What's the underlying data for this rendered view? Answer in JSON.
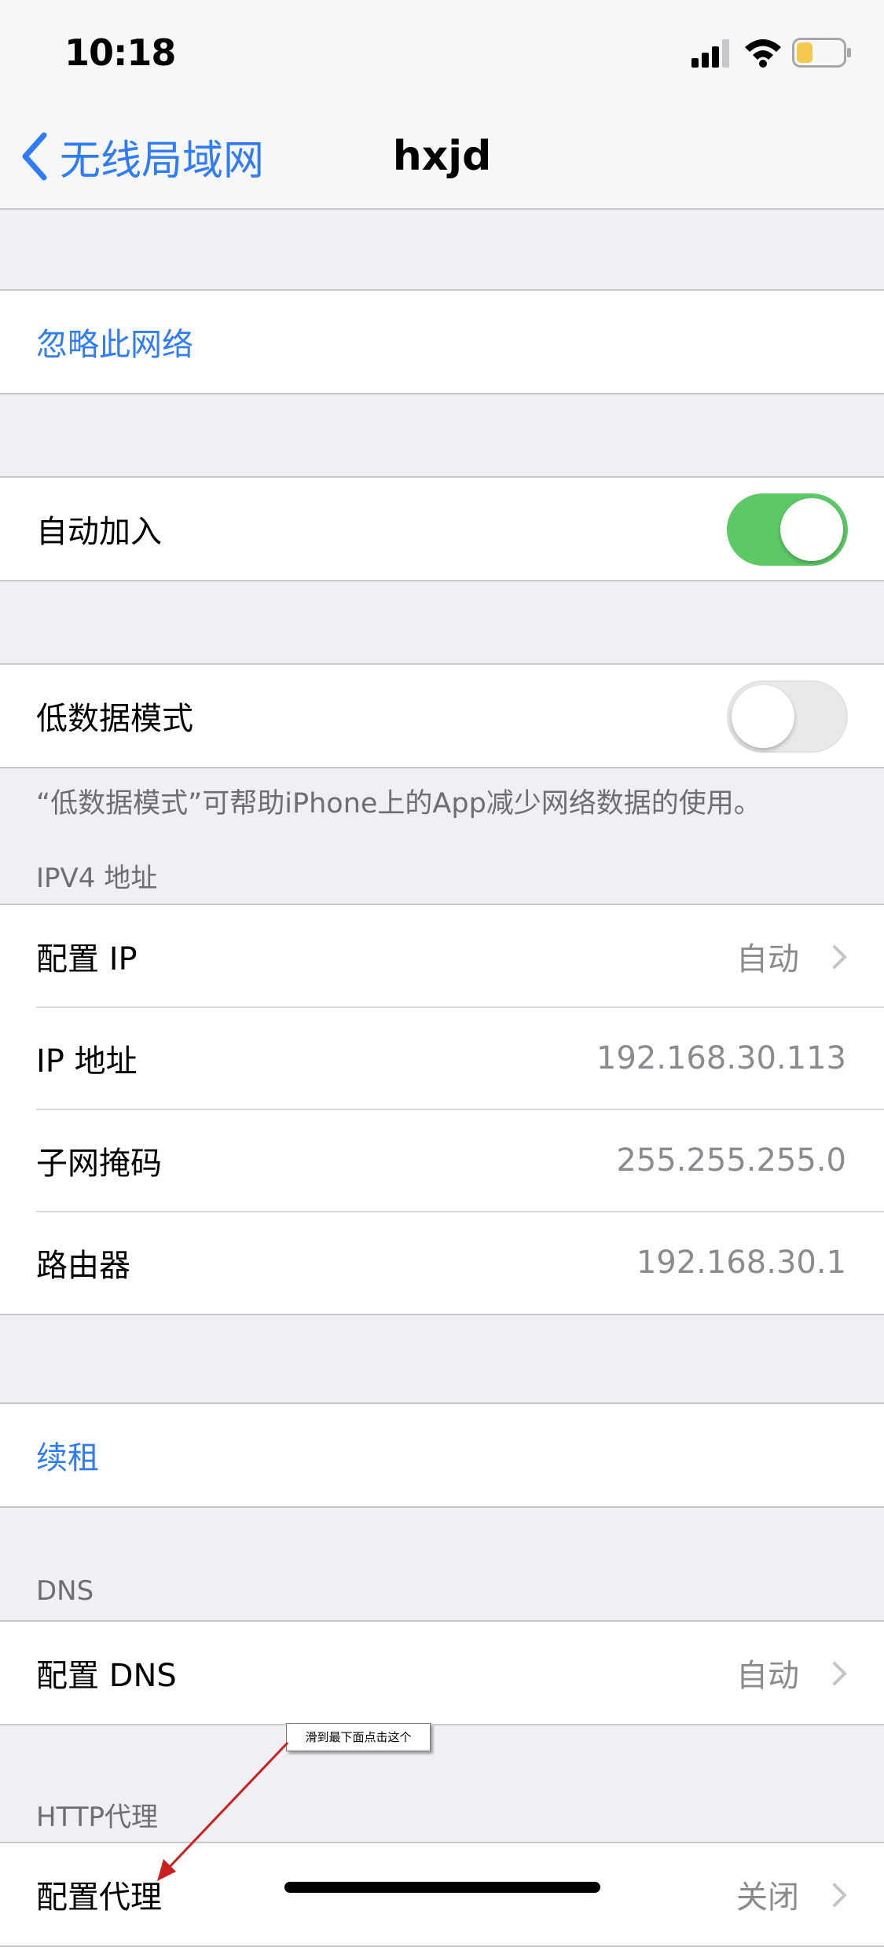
{
  "status": {
    "time": "10:18"
  },
  "nav": {
    "back_label": "无线局域网",
    "title": "hxjd"
  },
  "forget": {
    "label": "忽略此网络"
  },
  "auto_join": {
    "label": "自动加入",
    "enabled": true
  },
  "low_data": {
    "label": "低数据模式",
    "enabled": false,
    "footnote": "“低数据模式”可帮助iPhone上的App减少网络数据的使用。"
  },
  "ipv4": {
    "header": "IPV4 地址",
    "rows": [
      {
        "label": "配置 IP",
        "value": "自动"
      },
      {
        "label": "IP 地址",
        "value": "192.168.30.113"
      },
      {
        "label": "子网掩码",
        "value": "255.255.255.0"
      },
      {
        "label": "路由器",
        "value": "192.168.30.1"
      }
    ]
  },
  "renew": {
    "label": "续租"
  },
  "dns": {
    "header": "DNS",
    "label": "配置 DNS",
    "value": "自动"
  },
  "http_proxy": {
    "header": "HTTP代理",
    "label": "配置代理",
    "value": "关闭"
  },
  "annotation": {
    "text": "滑到最下面点击这个"
  },
  "colors": {
    "accent": "#2f7cf6",
    "toggle_on": "#5dc966",
    "annotation_arrow": "#cc1f1f"
  }
}
